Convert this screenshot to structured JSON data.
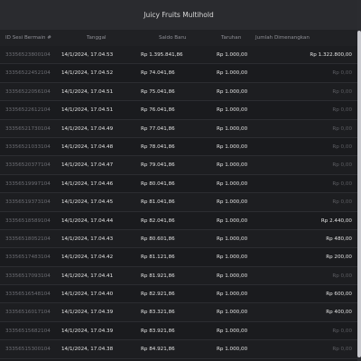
{
  "window": {
    "title": "Juicy Fruits Multihold"
  },
  "columns": {
    "id": "ID Sesi Bermain #",
    "date": "Tanggal",
    "balance": "Saldo Baru",
    "bet": "Taruhan",
    "win": "Jumlah Dimenangkan"
  },
  "rows": [
    {
      "id": "33356523800104",
      "date": "14/1/2024, 17.04.53",
      "balance": "Rp 1.395.841,86",
      "bet": "Rp 1.000,00",
      "win": "Rp 1.322.800,00",
      "win_zero": false
    },
    {
      "id": "33356522452104",
      "date": "14/1/2024, 17.04.52",
      "balance": "Rp 74.041,86",
      "bet": "Rp 1.000,00",
      "win": "Rp 0,00",
      "win_zero": true
    },
    {
      "id": "33356522056104",
      "date": "14/1/2024, 17.04.51",
      "balance": "Rp 75.041,86",
      "bet": "Rp 1.000,00",
      "win": "Rp 0,00",
      "win_zero": true
    },
    {
      "id": "33356522612104",
      "date": "14/1/2024, 17.04.51",
      "balance": "Rp 76.041,86",
      "bet": "Rp 1.000,00",
      "win": "Rp 0,00",
      "win_zero": true
    },
    {
      "id": "33356521730104",
      "date": "14/1/2024, 17.04.49",
      "balance": "Rp 77.041,86",
      "bet": "Rp 1.000,00",
      "win": "Rp 0,00",
      "win_zero": true
    },
    {
      "id": "33356521033104",
      "date": "14/1/2024, 17.04.48",
      "balance": "Rp 78.041,86",
      "bet": "Rp 1.000,00",
      "win": "Rp 0,00",
      "win_zero": true
    },
    {
      "id": "33356520377104",
      "date": "14/1/2024, 17.04.47",
      "balance": "Rp 79.041,86",
      "bet": "Rp 1.000,00",
      "win": "Rp 0,00",
      "win_zero": true
    },
    {
      "id": "33356519997104",
      "date": "14/1/2024, 17.04.46",
      "balance": "Rp 80.041,86",
      "bet": "Rp 1.000,00",
      "win": "Rp 0,00",
      "win_zero": true
    },
    {
      "id": "33356519373104",
      "date": "14/1/2024, 17.04.45",
      "balance": "Rp 81.041,86",
      "bet": "Rp 1.000,00",
      "win": "Rp 0,00",
      "win_zero": true
    },
    {
      "id": "33356518589104",
      "date": "14/1/2024, 17.04.44",
      "balance": "Rp 82.041,86",
      "bet": "Rp 1.000,00",
      "win": "Rp 2.440,00",
      "win_zero": false
    },
    {
      "id": "33356518052104",
      "date": "14/1/2024, 17.04.43",
      "balance": "Rp 80.601,86",
      "bet": "Rp 1.000,00",
      "win": "Rp 480,00",
      "win_zero": false
    },
    {
      "id": "33356517483104",
      "date": "14/1/2024, 17.04.42",
      "balance": "Rp 81.121,86",
      "bet": "Rp 1.000,00",
      "win": "Rp 200,00",
      "win_zero": false
    },
    {
      "id": "33356517093104",
      "date": "14/1/2024, 17.04.41",
      "balance": "Rp 81.921,86",
      "bet": "Rp 1.000,00",
      "win": "Rp 0,00",
      "win_zero": true
    },
    {
      "id": "33356516548104",
      "date": "14/1/2024, 17.04.40",
      "balance": "Rp 82.921,86",
      "bet": "Rp 1.000,00",
      "win": "Rp 600,00",
      "win_zero": false
    },
    {
      "id": "33356516017104",
      "date": "14/1/2024, 17.04.39",
      "balance": "Rp 83.321,86",
      "bet": "Rp 1.000,00",
      "win": "Rp 400,00",
      "win_zero": false
    },
    {
      "id": "33356515682104",
      "date": "14/1/2024, 17.04.39",
      "balance": "Rp 83.921,86",
      "bet": "Rp 1.000,00",
      "win": "Rp 0,00",
      "win_zero": true
    },
    {
      "id": "33356515300104",
      "date": "14/1/2024, 17.04.38",
      "balance": "Rp 84.921,86",
      "bet": "Rp 1.000,00",
      "win": "Rp 0,00",
      "win_zero": true
    }
  ],
  "colors": {
    "background": "#1b1c1f",
    "title_bar": "#2a2b2f",
    "text_primary": "#e4e4e4",
    "text_muted": "#6d6e74"
  }
}
